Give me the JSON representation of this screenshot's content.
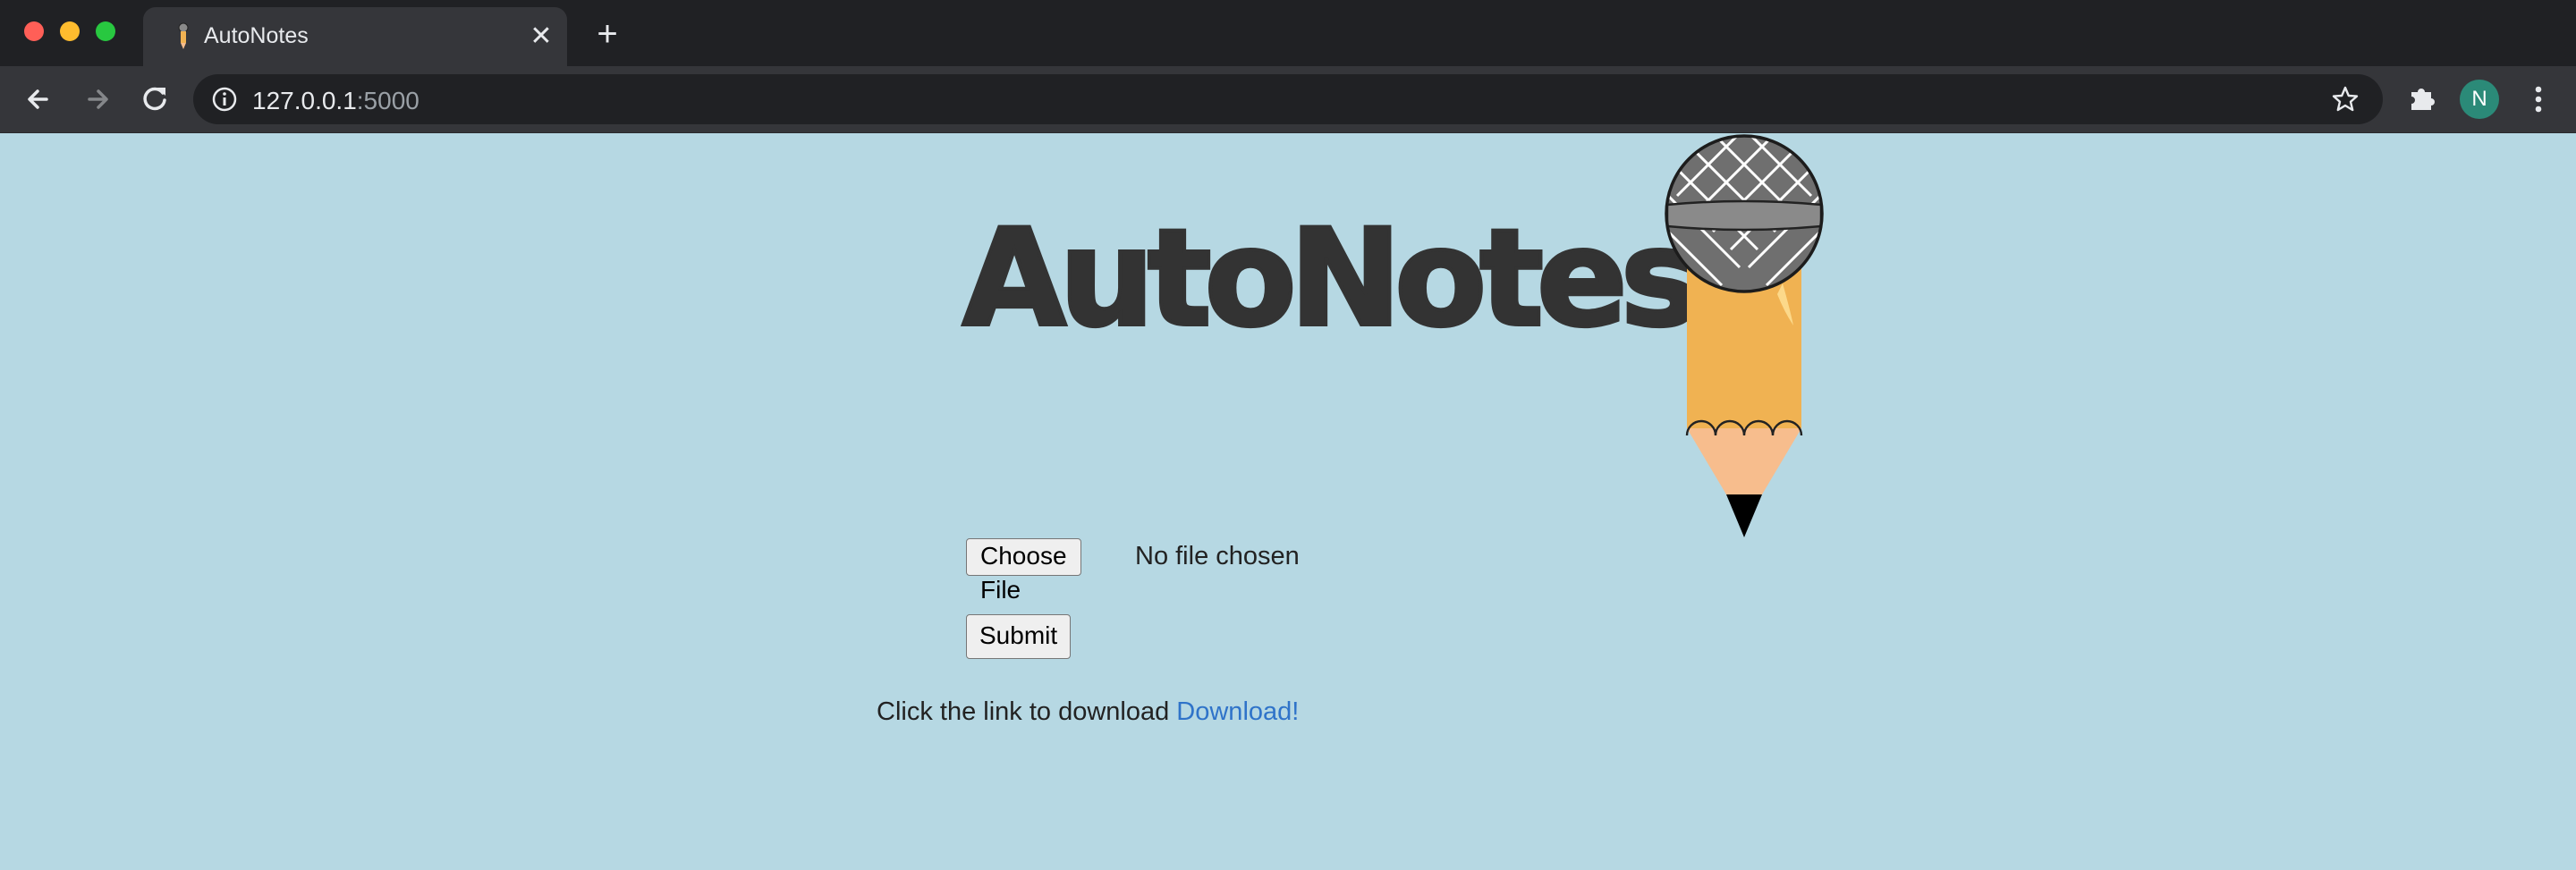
{
  "browser": {
    "tab_title": "AutoNotes",
    "url_host": "127.0.0.1",
    "url_port": ":5000",
    "profile_initial": "N"
  },
  "page": {
    "title": "AutoNotes",
    "file_button_label": "Choose File",
    "file_status": "No file chosen",
    "submit_label": "Submit",
    "download_prompt": "Click the link to download",
    "download_link_label": "Download!"
  },
  "icons": {
    "favicon": "pencil-mic-favicon",
    "mascot": "microphone-pencil-logo",
    "back": "arrow-left-icon",
    "forward": "arrow-right-icon",
    "reload": "reload-icon",
    "info": "info-icon",
    "star": "star-icon",
    "extensions": "puzzle-icon",
    "menu": "kebab-menu-icon"
  },
  "colors": {
    "page_background": "#b6d8e3",
    "title": "#333333",
    "link": "#2f73c9",
    "pencil_body": "#f0b252",
    "pencil_wood": "#f7bd8d"
  }
}
